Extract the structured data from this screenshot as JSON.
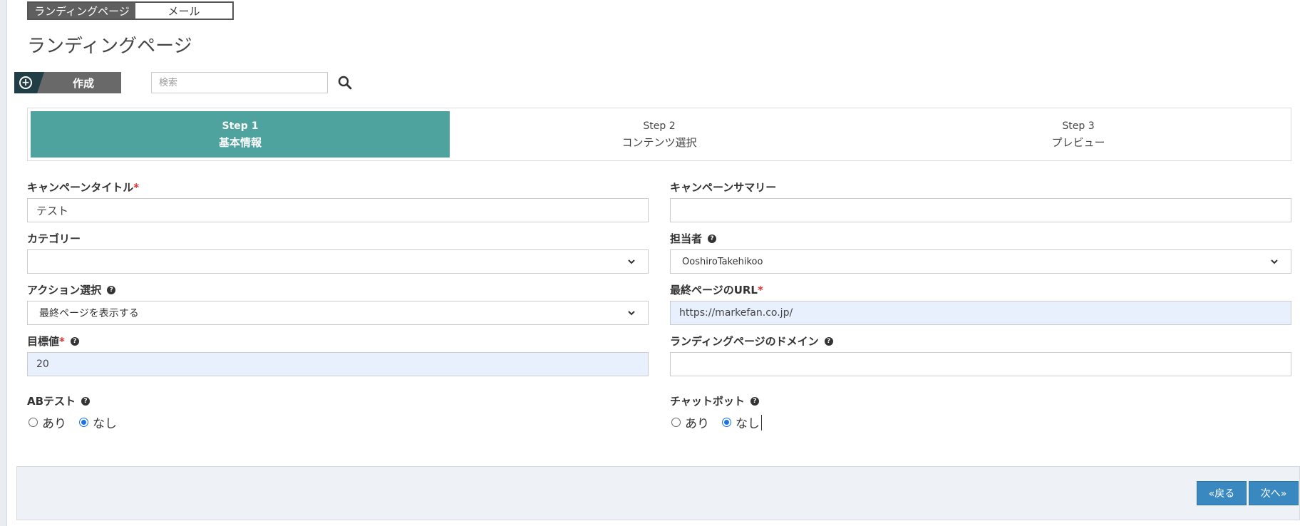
{
  "type_tabs": {
    "landing": "ランディングページ",
    "mail": "メール"
  },
  "page_title": "ランディングページ",
  "toolbar": {
    "create_label": "作成",
    "search_placeholder": "検索"
  },
  "steps": [
    {
      "num": "Step 1",
      "name": "基本情報"
    },
    {
      "num": "Step 2",
      "name": "コンテンツ選択"
    },
    {
      "num": "Step 3",
      "name": "プレビュー"
    }
  ],
  "form": {
    "campaign_title": {
      "label": "キャンペーンタイトル",
      "required": "*",
      "value": "テスト"
    },
    "campaign_summary": {
      "label": "キャンペーンサマリー",
      "value": ""
    },
    "category": {
      "label": "カテゴリー",
      "value": ""
    },
    "owner": {
      "label": "担当者",
      "value": "OoshiroTakehikoo"
    },
    "action": {
      "label": "アクション選択",
      "value": "最終ページを表示する"
    },
    "final_url": {
      "label": "最終ページのURL",
      "required": "*",
      "value": "https://markefan.co.jp/"
    },
    "target": {
      "label": "目標値",
      "required": "*",
      "value": "20"
    },
    "domain": {
      "label": "ランディングページのドメイン",
      "value": ""
    },
    "ab_test": {
      "label": "ABテスト",
      "opt_yes": "あり",
      "opt_no": "なし",
      "selected": "なし"
    },
    "chatbot": {
      "label": "チャットボット",
      "opt_yes": "あり",
      "opt_no": "なし",
      "selected": "なし"
    }
  },
  "footer": {
    "back_label": "«戻る",
    "next_label": "次へ»"
  },
  "colors": {
    "step_active": "#4fa39e",
    "button_blue": "#3a88c0",
    "autofill_bg": "#e8f0fe"
  }
}
